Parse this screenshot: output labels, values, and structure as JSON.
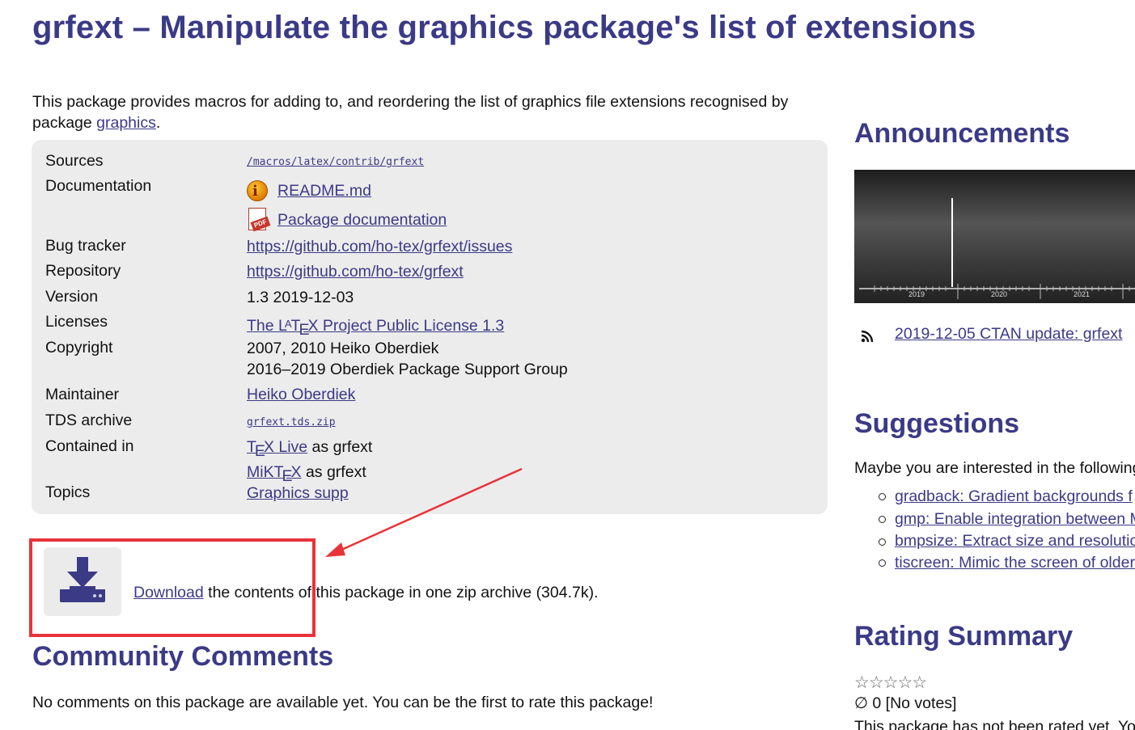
{
  "page": {
    "title": "grfext – Manipulate the graphics package's list of extensions",
    "description_before": "This package provides macros for adding to, and reordering the list of graphics file extensions recognised by package ",
    "description_link": "graphics",
    "description_after": "."
  },
  "info": {
    "sources_label": "Sources",
    "sources_value": "/macros/latex/contrib/grfext",
    "documentation_label": "Documentation",
    "doc_readme": "README.md",
    "doc_package": "Package documentation",
    "bugtracker_label": "Bug tracker",
    "bugtracker_value": "https://github.com/ho-tex/grfext/issues",
    "repository_label": "Repository",
    "repository_value": "https://github.com/ho-tex/grfext",
    "version_label": "Version",
    "version_value": "1.3 2019-12-03",
    "licenses_label": "Licenses",
    "license_prefix": "The L",
    "license_a": "A",
    "license_t": "T",
    "license_e": "E",
    "license_x_suffix": "X Project Public License 1.3",
    "copyright_label": "Copyright",
    "copyright_line1": "2007, 2010 Heiko Oberdiek",
    "copyright_line2": "2016–2019 Oberdiek Package Support Group",
    "maintainer_label": "Maintainer",
    "maintainer_value": "Heiko Oberdiek",
    "tds_label": "TDS archive",
    "tds_value": "grfext.tds.zip",
    "contained_label": "Contained in",
    "texlive_t": "T",
    "texlive_e": "E",
    "texlive_x": "X Live",
    "texlive_as": " as grfext",
    "miktex_mik": "MiKT",
    "miktex_e": "E",
    "miktex_x": "X",
    "miktex_as": " as grfext",
    "topics_label": "Topics",
    "topics_value": "Graphics supp"
  },
  "download": {
    "link": "Download",
    "text": " the contents of this package in one zip archive (304.7k)."
  },
  "comments": {
    "heading": "Community Comments",
    "text": "No comments on this package are available yet. You can be the first to rate this package!"
  },
  "sidebar": {
    "announcements_heading": "Announcements",
    "timeline_years": [
      "2019",
      "2020",
      "2021"
    ],
    "feed_link": "2019-12-05 CTAN update: grfext",
    "suggestions_heading": "Suggestions",
    "suggestions_intro": "Maybe you are interested in the following",
    "suggestions": [
      "gradback: Gradient backgrounds f",
      "gmp: Enable integration between M",
      "bmpsize: Extract size and resolutio",
      "tiscreen: Mimic the screen of older"
    ],
    "rating_heading": "Rating Summary",
    "stars": "☆☆☆☆☆",
    "votes": "∅ 0 [No votes]",
    "not_rated": "This package has not been rated yet. Yo"
  },
  "colors": {
    "heading": "#3b3a86",
    "link": "#3b3a86",
    "highlight": "#e8333a",
    "info_bg": "#ececec"
  }
}
